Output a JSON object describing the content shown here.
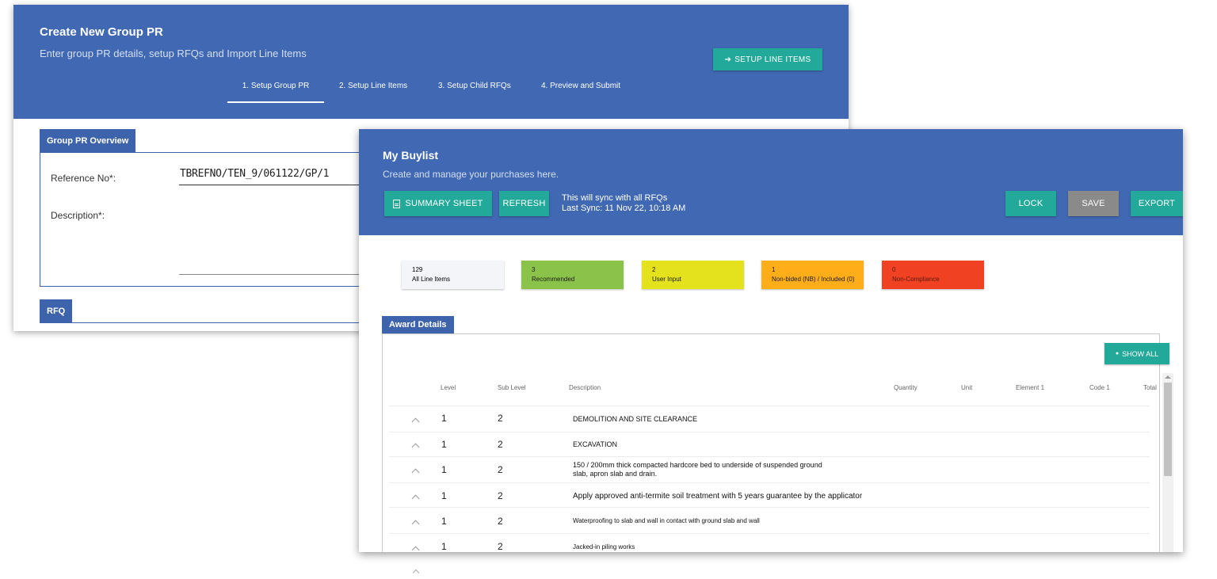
{
  "group_pr": {
    "title": "Create New Group PR",
    "subtitle": "Enter group PR details, setup RFQs and Import Line Items",
    "setup_button": "SETUP LINE ITEMS",
    "steps": [
      {
        "label": "1. Setup Group PR"
      },
      {
        "label": "2. Setup Line Items"
      },
      {
        "label": "3. Setup Child RFQs"
      },
      {
        "label": "4. Preview and Submit"
      }
    ],
    "active_step": "1. Setup Group PR",
    "overview_tab": "Group PR Overview",
    "reference_label": "Reference No*:",
    "reference_value": "TBREFNO/TEN_9/061122/GP/1",
    "description_label": "Description*:",
    "rfq_tab": "RFQ"
  },
  "buylist": {
    "title": "My Buylist",
    "subtitle": "Create and manage your purchases here.",
    "buttons": {
      "summary": "SUMMARY SHEET",
      "refresh": "REFRESH",
      "lock": "LOCK",
      "save": "SAVE",
      "export": "EXPORT"
    },
    "sync_line1": "This will sync with all RFQs",
    "sync_line2": "Last Sync: 11 Nov 22, 10:18 AM",
    "stats": [
      {
        "count": "129",
        "label": "All Line Items",
        "color": "#f3f5f8",
        "text_color": "#000000"
      },
      {
        "count": "3",
        "label": "Recommended",
        "color": "#8bc34a",
        "text_color": "#1a1a1a"
      },
      {
        "count": "2",
        "label": "User Input",
        "color": "#e3e21d",
        "text_color": "#1a1a1a"
      },
      {
        "count": "1",
        "label": "Non-bided (NB) / Included (0)",
        "color": "#ffae19",
        "text_color": "#1a1a1a"
      },
      {
        "count": "0",
        "label": "Non-Compliance",
        "color": "#f04123",
        "text_color": "#5a1a10"
      }
    ],
    "award_tab": "Award Details",
    "show_all": "SHOW ALL",
    "columns": {
      "level": "Level",
      "sub_level": "Sub Level",
      "description": "Description",
      "quantity": "Quantity",
      "unit": "Unit",
      "element1": "Element 1",
      "code1": "Code 1",
      "total": "Total"
    },
    "rows": [
      {
        "level": "1",
        "sub_level": "2",
        "description_1": "DEMOLITION AND SITE CLEARANCE",
        "description_2": ""
      },
      {
        "level": "1",
        "sub_level": "2",
        "description_1": "EXCAVATION",
        "description_2": ""
      },
      {
        "level": "1",
        "sub_level": "2",
        "description_1": "150 / 200mm thick compacted hardcore bed to underside of suspended ground",
        "description_2": "slab, apron slab and drain."
      },
      {
        "level": "1",
        "sub_level": "2",
        "description_1": "Apply approved anti-termite soil treatment with 5 years guarantee by the applicator",
        "description_2": ""
      },
      {
        "level": "1",
        "sub_level": "2",
        "description_1": "Waterproofing to slab and wall in contact with ground slab and wall",
        "description_2": ""
      },
      {
        "level": "1",
        "sub_level": "2",
        "description_1": "Jacked-in piling works",
        "description_2": ""
      }
    ]
  },
  "colors": {
    "header_blue": "#4068b3",
    "teal": "#23a99a",
    "gray_button": "#8a8a8a"
  }
}
